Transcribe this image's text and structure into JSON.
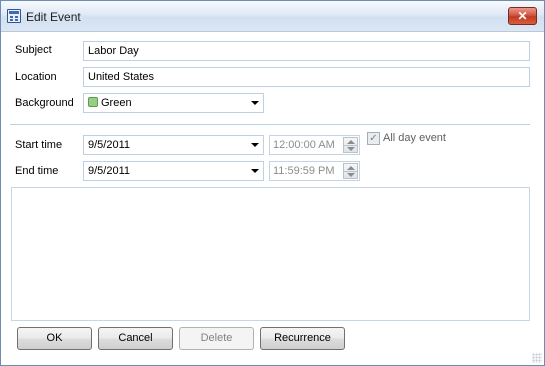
{
  "window": {
    "title": "Edit Event",
    "close_glyph": "✕",
    "icon": "calendar-icon"
  },
  "form": {
    "subject": {
      "label": "Subject",
      "value": "Labor Day"
    },
    "location": {
      "label": "Location",
      "value": "United States"
    },
    "background": {
      "label": "Background",
      "value": "Green",
      "swatch_color": "#93d083"
    },
    "start": {
      "label": "Start time",
      "date": "9/5/2011",
      "time": "12:00:00 AM"
    },
    "end": {
      "label": "End time",
      "date": "9/5/2011",
      "time": "11:59:59 PM"
    },
    "all_day": {
      "label": "All day event",
      "checked": true,
      "check_glyph": "✓"
    },
    "description": {
      "value": ""
    }
  },
  "buttons": {
    "ok": "OK",
    "cancel": "Cancel",
    "delete": "Delete",
    "recurrence": "Recurrence"
  }
}
